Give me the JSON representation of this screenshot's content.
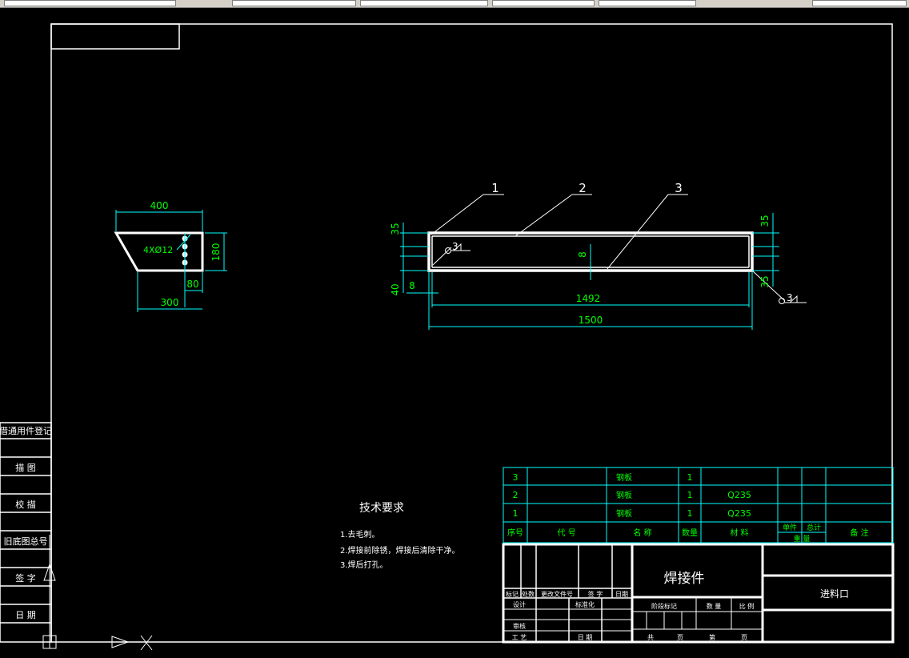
{
  "colors": {
    "background": "#000000",
    "frame": "#ffffff",
    "dimension": "#00ff00",
    "dimension_line": "#00ffff",
    "title_block": "#00ffff",
    "table_text": "#00ff00"
  },
  "views": {
    "left": {
      "top_width": "400",
      "bottom_width": "300",
      "height": "180",
      "hole_spacing": "80",
      "holes": "4XØ12"
    },
    "right": {
      "leader_1": "1",
      "leader_2": "2",
      "leader_3": "3",
      "dim_top": "35",
      "dim_bottom": "40",
      "dim_side": "8",
      "dim_plate": "8",
      "dim_right_top": "35",
      "dim_right_bottom": "35",
      "inner_length": "1492",
      "total_length": "1500",
      "weld_left": "3",
      "weld_right": "3"
    }
  },
  "tech": {
    "title": "技术要求",
    "items": [
      "1.去毛刺。",
      "2.焊接前除锈，焊接后清除干净。",
      "3.焊后打孔。"
    ]
  },
  "side_labels": [
    "借通用件登记",
    "描 图",
    "校 描",
    "旧底图总号",
    "签 字",
    "日 期"
  ],
  "bom": {
    "rows": [
      {
        "no": "3",
        "code": "",
        "name": "钢板",
        "qty": "1",
        "material": ""
      },
      {
        "no": "2",
        "code": "",
        "name": "钢板",
        "qty": "1",
        "material": "Q235"
      },
      {
        "no": "1",
        "code": "",
        "name": "钢板",
        "qty": "1",
        "material": "Q235"
      }
    ],
    "headers": {
      "no": "序号",
      "code": "代 号",
      "name": "名 称",
      "qty": "数量",
      "material": "材 料",
      "single": "单件",
      "total": "总计",
      "weight": "重 量",
      "remark": "备 注"
    }
  },
  "title_block": {
    "part_name": "焊接件",
    "drawing_name": "进料口",
    "labels": {
      "mark": "标记",
      "count": "处数",
      "change": "更改文件号",
      "sign": "签 字",
      "date": "日期",
      "design": "设计",
      "standard": "标准化",
      "review": "审核",
      "process": "工 艺",
      "date2": "日 期",
      "stage": "阶段标记",
      "weight": "数 量",
      "scale": "比 例",
      "total_pages": "共",
      "pages": "页",
      "sheet": "第",
      "sheet_pages": "页"
    }
  }
}
